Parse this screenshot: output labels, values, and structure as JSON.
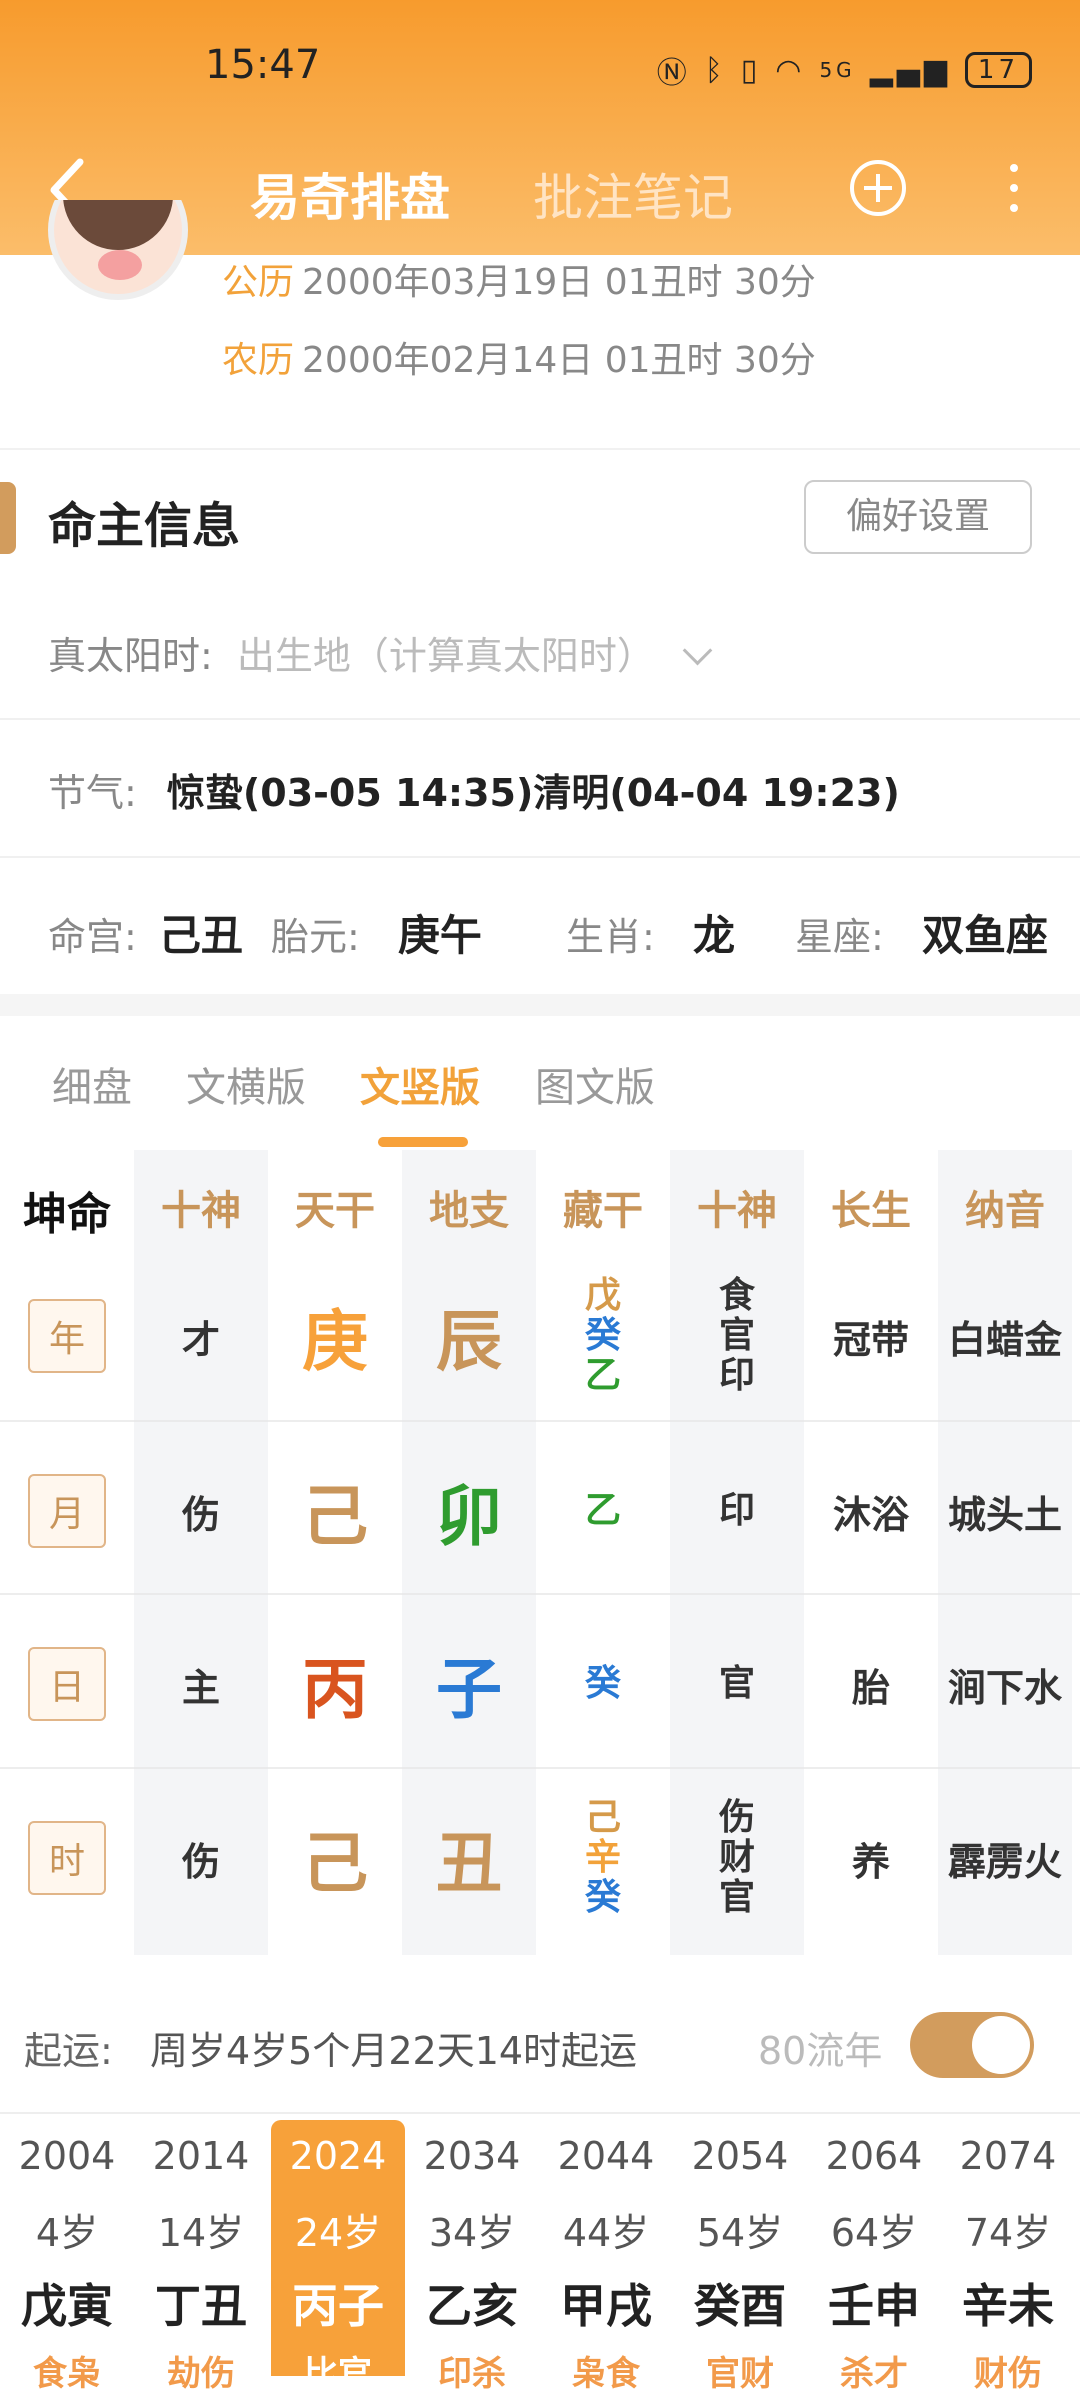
{
  "status_bar": {
    "time": "15:47",
    "network": "5G",
    "battery": "17"
  },
  "nav": {
    "title": "易奇排盘",
    "secondary_tab": "批注笔记"
  },
  "profile": {
    "solar_label": "公历",
    "solar_value": "2000年03月19日 01丑时 30分",
    "lunar_label": "农历",
    "lunar_value": "2000年02月14日 01丑时 30分"
  },
  "section": {
    "title": "命主信息",
    "pref_button": "偏好设置"
  },
  "true_solar": {
    "label": "真太阳时:",
    "placeholder": "出生地（计算真太阳时）"
  },
  "jieqi": {
    "label": "节气:",
    "value": "惊蛰(03-05 14:35)清明(04-04 19:23)"
  },
  "info": {
    "minggong_label": "命宫:",
    "minggong": "己丑",
    "taiyuan_label": "胎元:",
    "taiyuan": "庚午",
    "shengxiao_label": "生肖:",
    "shengxiao": "龙",
    "xingzuo_label": "星座:",
    "xingzuo": "双鱼座"
  },
  "tabs": [
    "细盘",
    "文横版",
    "文竖版",
    "图文版"
  ],
  "active_tab": "文竖版",
  "chart": {
    "corner": "坤命",
    "headers": [
      "十神",
      "天干",
      "地支",
      "藏干",
      "十神",
      "长生",
      "纳音"
    ],
    "rows": [
      {
        "pillar": "年",
        "shishen": "才",
        "tiangan": "庚",
        "tiangan_color": "#f7a13a",
        "dizhi": "辰",
        "dizhi_color": "#c8955a",
        "canggan": [
          {
            "c": "戊",
            "color": "#d59a4a"
          },
          {
            "c": "癸",
            "color": "#2a7ad4"
          },
          {
            "c": "乙",
            "color": "#2f9c2f"
          }
        ],
        "shishen2": [
          "食",
          "官",
          "印"
        ],
        "changsheng": "冠带",
        "nayin": "白蜡金"
      },
      {
        "pillar": "月",
        "shishen": "伤",
        "tiangan": "己",
        "tiangan_color": "#c8955a",
        "dizhi": "卯",
        "dizhi_color": "#2f9c2f",
        "canggan": [
          {
            "c": "乙",
            "color": "#2f9c2f"
          }
        ],
        "shishen2": [
          "印"
        ],
        "changsheng": "沐浴",
        "nayin": "城头土"
      },
      {
        "pillar": "日",
        "shishen": "主",
        "tiangan": "丙",
        "tiangan_color": "#d9541f",
        "dizhi": "子",
        "dizhi_color": "#2a7ad4",
        "canggan": [
          {
            "c": "癸",
            "color": "#2a7ad4"
          }
        ],
        "shishen2": [
          "官"
        ],
        "changsheng": "胎",
        "nayin": "涧下水"
      },
      {
        "pillar": "时",
        "shishen": "伤",
        "tiangan": "己",
        "tiangan_color": "#c8955a",
        "dizhi": "丑",
        "dizhi_color": "#c8955a",
        "canggan": [
          {
            "c": "己",
            "color": "#d59a4a"
          },
          {
            "c": "辛",
            "color": "#f2a23a"
          },
          {
            "c": "癸",
            "color": "#2a7ad4"
          }
        ],
        "shishen2": [
          "伤",
          "财",
          "官"
        ],
        "changsheng": "养",
        "nayin": "霹雳火"
      }
    ]
  },
  "qiyun": {
    "label": "起运:",
    "value": "周岁4岁5个月22天14时起运",
    "liunian_label": "80流年",
    "toggle_on": true
  },
  "dayun": [
    {
      "year": "2004",
      "age": "4岁",
      "gz": "戊寅",
      "sub": "食枭"
    },
    {
      "year": "2014",
      "age": "14岁",
      "gz": "丁丑",
      "sub": "劫伤"
    },
    {
      "year": "2024",
      "age": "24岁",
      "gz": "丙子",
      "sub": "比官",
      "active": true
    },
    {
      "year": "2034",
      "age": "34岁",
      "gz": "乙亥",
      "sub": "印杀"
    },
    {
      "year": "2044",
      "age": "44岁",
      "gz": "甲戌",
      "sub": "枭食"
    },
    {
      "year": "2054",
      "age": "54岁",
      "gz": "癸酉",
      "sub": "官财"
    },
    {
      "year": "2064",
      "age": "64岁",
      "gz": "壬申",
      "sub": "杀才"
    },
    {
      "year": "2074",
      "age": "74岁",
      "gz": "辛未",
      "sub": "财伤"
    }
  ]
}
